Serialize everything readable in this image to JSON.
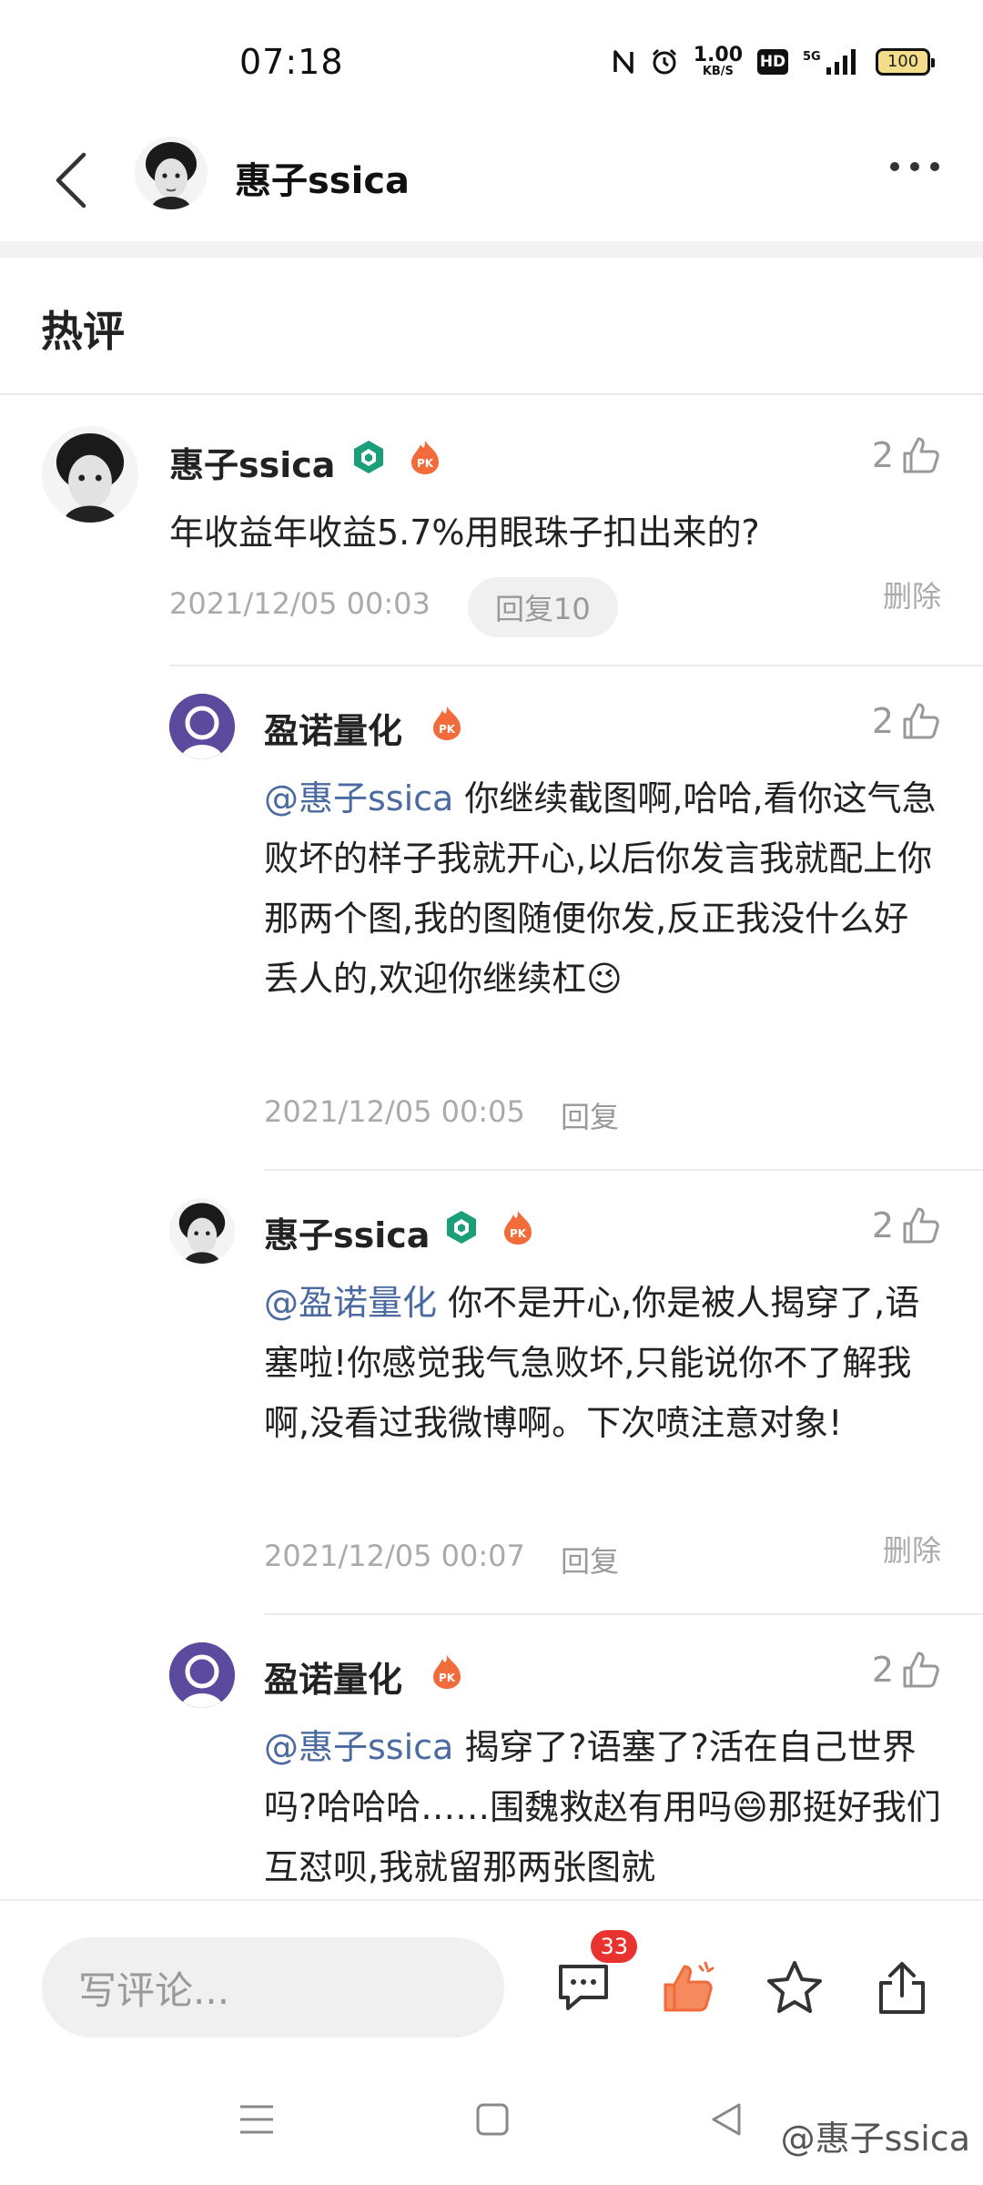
{
  "status_bar": {
    "time": "07:18",
    "speed_value": "1.00",
    "speed_unit": "KB/S",
    "hd": "HD",
    "network": "5G",
    "battery": "100"
  },
  "header": {
    "title": "惠子ssica"
  },
  "section": {
    "title": "热评"
  },
  "comments": [
    {
      "name": "惠子ssica",
      "likes": "2",
      "mention": "",
      "text": "年收益年收益5.7%用眼珠子扣出来的?",
      "time": "2021/12/05 00:03",
      "reply": "回复10",
      "delete": "删除"
    },
    {
      "name": "盈诺量化",
      "likes": "2",
      "mention": "@惠子ssica",
      "text": " 你继续截图啊,哈哈,看你这气急败坏的样子我就开心,以后你发言我就配上你那两个图,我的图随便你发,反正我没什么好丢人的,欢迎你继续杠😉",
      "time": "2021/12/05 00:05",
      "reply": "回复"
    },
    {
      "name": "惠子ssica",
      "likes": "2",
      "mention": "@盈诺量化",
      "text": " 你不是开心,你是被人揭穿了,语塞啦!你感觉我气急败坏,只能说你不了解我啊,没看过我微博啊。下次喷注意对象!",
      "time": "2021/12/05 00:07",
      "reply": "回复",
      "delete": "删除"
    },
    {
      "name": "盈诺量化",
      "likes": "2",
      "mention": "@惠子ssica",
      "text": " 揭穿了?语塞了?活在自己世界吗?哈哈哈……围魏救赵有用吗😄那挺好我们互怼呗,我就留那两张图就"
    }
  ],
  "bottom_bar": {
    "placeholder": "写评论...",
    "comment_count": "33"
  },
  "watermark": "@惠子ssica",
  "colors": {
    "mention": "#4a6aa0",
    "like_active": "#f26b3a",
    "badge": "#e9332e",
    "verified": "#1a9f7a"
  },
  "icons": [
    "back-arrow-icon",
    "more-icon",
    "thumb-up-icon",
    "verified-badge-icon",
    "pk-fire-icon",
    "comment-icon",
    "like-icon",
    "star-icon",
    "share-icon",
    "menu-icon",
    "home-icon",
    "back-icon"
  ]
}
